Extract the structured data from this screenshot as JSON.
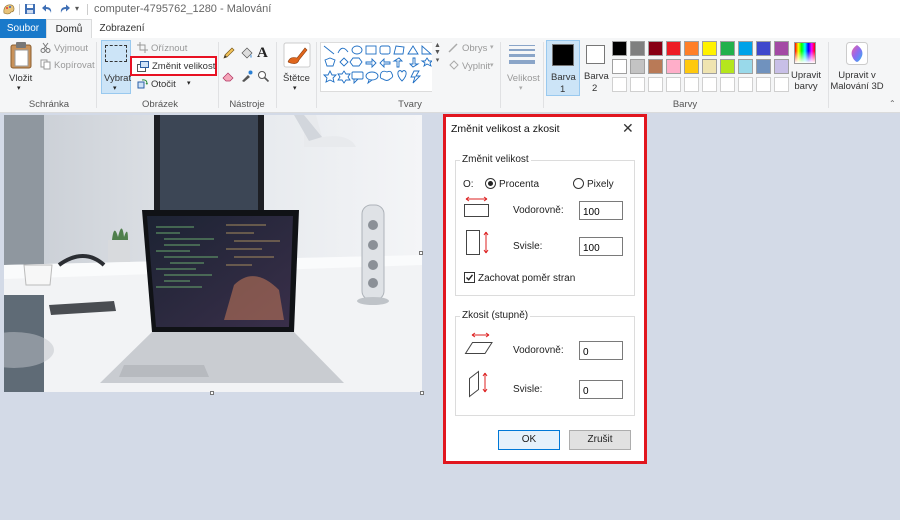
{
  "window": {
    "title": "computer-4795762_1280 - Malování"
  },
  "tabs": {
    "file": "Soubor",
    "home": "Domů",
    "view": "Zobrazení"
  },
  "ribbon": {
    "clipboard": {
      "paste": "Vložit",
      "cut": "Vyjmout",
      "copy": "Kopírovat",
      "label": "Schránka"
    },
    "image": {
      "select": "Vybrat",
      "crop": "Oříznout",
      "resize": "Změnit velikost",
      "rotate": "Otočit",
      "label": "Obrázek"
    },
    "tools": {
      "label": "Nástroje"
    },
    "brushes": {
      "label": "Štětce"
    },
    "shapes": {
      "outline": "Obrys",
      "fill": "Vyplnit",
      "label": "Tvary"
    },
    "size": {
      "label": "Velikost"
    },
    "color1": {
      "label": "Barva",
      "num": "1"
    },
    "color2": {
      "label": "Barva",
      "num": "2"
    },
    "colors": {
      "label": "Barvy",
      "edit": "Upravit barvy",
      "palette_row1": [
        "#000000",
        "#7f7f7f",
        "#880015",
        "#ed1c24",
        "#ff7f27",
        "#fff200",
        "#22b14c",
        "#00a2e8",
        "#3f48cc",
        "#a349a4"
      ],
      "palette_row2": [
        "#ffffff",
        "#c3c3c3",
        "#b97a57",
        "#ffaec9",
        "#ffc90e",
        "#efe4b0",
        "#b5e61d",
        "#99d9ea",
        "#7092be",
        "#c8bfe7"
      ]
    },
    "paint3d": {
      "label": "Upravit v Malování 3D"
    }
  },
  "dialog": {
    "title": "Změnit velikost a zkosit",
    "resize_group": "Změnit velikost",
    "by_label": "O:",
    "percent": "Procenta",
    "pixels": "Pixely",
    "horizontal": "Vodorovně:",
    "vertical": "Svisle:",
    "resize_h": "100",
    "resize_v": "100",
    "keep_ratio": "Zachovat poměr stran",
    "skew_group": "Zkosit (stupně)",
    "skew_h": "0",
    "skew_v": "0",
    "ok": "OK",
    "cancel": "Zrušit"
  }
}
